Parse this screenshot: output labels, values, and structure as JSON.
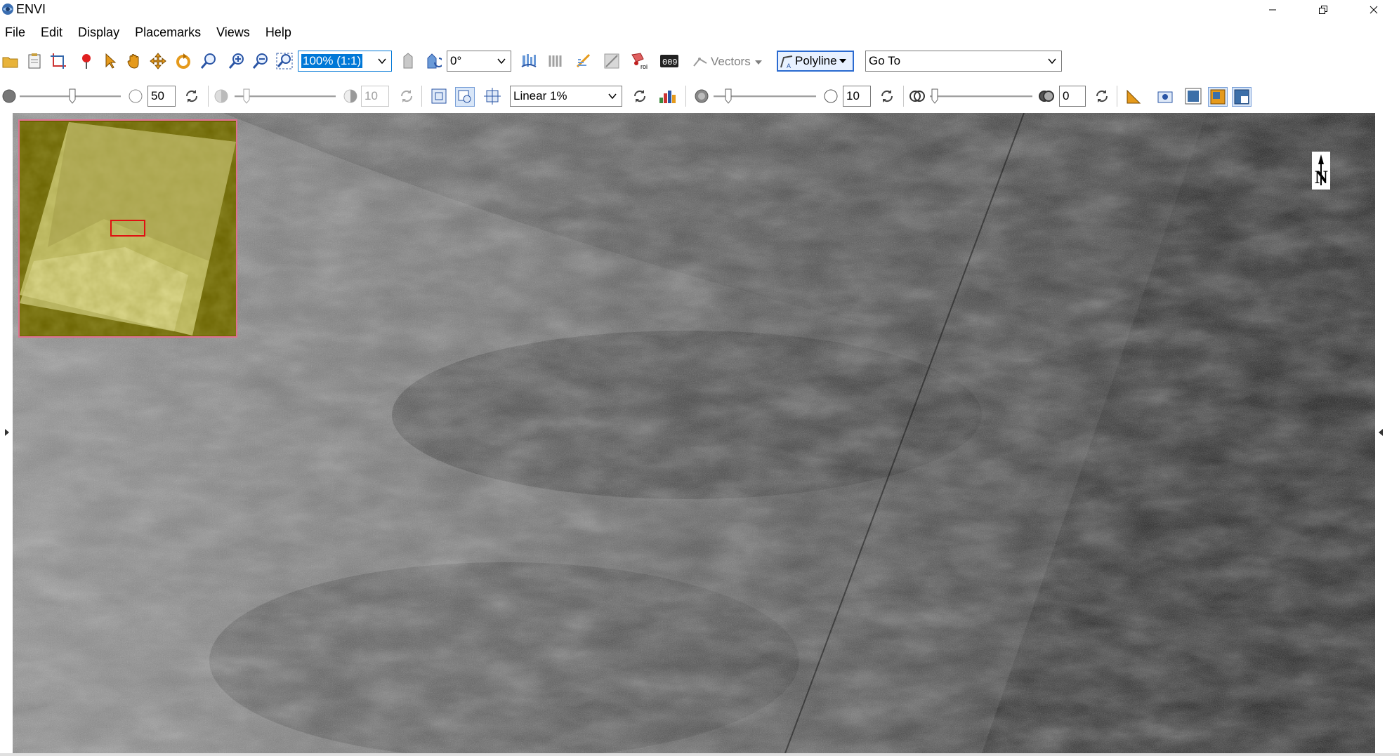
{
  "window": {
    "title": "ENVI"
  },
  "menu": [
    "File",
    "Edit",
    "Display",
    "Placemarks",
    "Views",
    "Help"
  ],
  "toolbar1": {
    "zoom_value": "100% (1:1)",
    "rotation_value": "0°",
    "vectors_label": "Vectors",
    "annotation_mode": "Polyline",
    "goto_placeholder": "Go To"
  },
  "toolbar2": {
    "brightness_value": "50",
    "contrast_value": "10",
    "stretch_value": "Linear 1%",
    "sharpen_value": "10",
    "transparency_value": "0"
  },
  "north_arrow": {
    "letter": "N"
  },
  "colors": {
    "overview_bg": "#6b6400",
    "selection_box": "#e01010",
    "accent": "#0078d7"
  }
}
